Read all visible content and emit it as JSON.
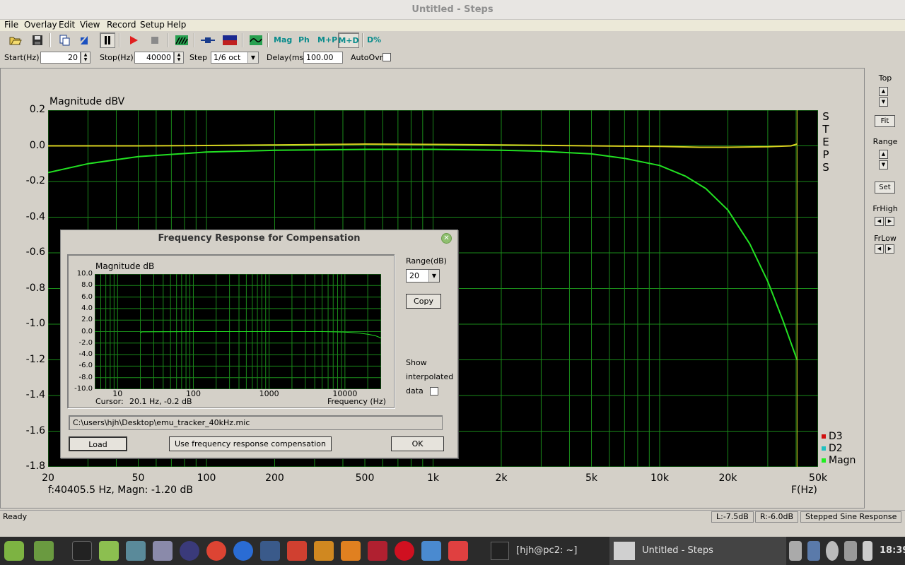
{
  "window": {
    "title": "Untitled - Steps"
  },
  "menu": [
    "File",
    "Overlay",
    "Edit",
    "View",
    "Record",
    "Setup",
    "Help"
  ],
  "toolbar": {
    "icons": [
      "open-icon",
      "save-icon",
      "copy-icon",
      "cursor-icon",
      "pause-icon",
      "play-icon",
      "stop-icon",
      "sweep-icon",
      "probe-icon",
      "calibrate-icon",
      "spectrum-icon"
    ],
    "mag_label": "Mag",
    "ph_label": "Ph",
    "mp_label": "M+P",
    "md_label": "M+D",
    "dpct_label": "D%"
  },
  "params": {
    "start_label": "Start(Hz)",
    "start_value": "20",
    "stop_label": "Stop(Hz)",
    "stop_value": "40000",
    "step_label": "Step",
    "step_value": "1/6 oct",
    "delay_label": "Delay(ms)",
    "delay_value": "100.00",
    "autoovr_label": "AutoOvr"
  },
  "chart_data": [
    {
      "type": "line",
      "title": "Magnitude dBV",
      "xlabel": "F(Hz)",
      "xscale": "log",
      "xlim": [
        20,
        50000
      ],
      "ylim": [
        -1.8,
        0.2
      ],
      "x_ticks": [
        "20",
        "50",
        "100",
        "200",
        "500",
        "1k",
        "2k",
        "5k",
        "10k",
        "20k",
        "50k"
      ],
      "y_ticks": [
        "0.2",
        "0.0",
        "-0.2",
        "-0.4",
        "-0.6",
        "-0.8",
        "-1.0",
        "-1.2",
        "-1.4",
        "-1.6",
        "-1.8"
      ],
      "grid": true,
      "side_label": "STEPS",
      "legend": [
        "D3",
        "D2",
        "Magn"
      ],
      "legend_colors": [
        "#d01010",
        "#20c0c0",
        "#20ee20"
      ],
      "cursor_x": 40405.5,
      "series": [
        {
          "name": "Magn",
          "color": "#22e022",
          "x": [
            20,
            30,
            50,
            100,
            200,
            500,
            1000,
            2000,
            3000,
            5000,
            7000,
            10000,
            13000,
            16000,
            20000,
            25000,
            30000,
            35000,
            40405
          ],
          "y": [
            -0.15,
            -0.1,
            -0.06,
            -0.035,
            -0.025,
            -0.02,
            -0.02,
            -0.025,
            -0.03,
            -0.045,
            -0.07,
            -0.11,
            -0.17,
            -0.24,
            -0.36,
            -0.55,
            -0.76,
            -0.98,
            -1.2
          ]
        },
        {
          "color": "#d8d020",
          "x": [
            20,
            50,
            100,
            200,
            500,
            1000,
            2000,
            5000,
            10000,
            15000,
            20000,
            30000,
            38000,
            40405
          ],
          "y": [
            0.0,
            0.0,
            0.002,
            0.005,
            0.01,
            0.008,
            0.005,
            0.0,
            -0.003,
            -0.008,
            -0.008,
            -0.005,
            0.0,
            0.01
          ]
        }
      ]
    },
    {
      "type": "line",
      "title": "Magnitude dB",
      "xlabel": "Frequency (Hz)",
      "xscale": "log",
      "xlim": [
        5,
        30000
      ],
      "ylim": [
        -10,
        10
      ],
      "x_ticks": [
        "10",
        "100",
        "1000",
        "10000"
      ],
      "y_ticks": [
        "10.0",
        "8.0",
        "6.0",
        "4.0",
        "2.0",
        "0.0",
        "-2.0",
        "-4.0",
        "-6.0",
        "-8.0",
        "-10.0"
      ],
      "grid": true,
      "series": [
        {
          "color": "#22e022",
          "x": [
            20,
            21,
            100,
            1000,
            5000,
            10000,
            15000,
            20000,
            25000,
            30000
          ],
          "y": [
            -0.2,
            -0.05,
            0.0,
            0.0,
            0.0,
            -0.1,
            -0.25,
            -0.45,
            -0.7,
            -1.1
          ]
        }
      ]
    }
  ],
  "main": {
    "readout": "f:40405.5 Hz, Magn: -1.20 dB"
  },
  "right_panel": {
    "top_label": "Top",
    "fit_label": "Fit",
    "range_label": "Range",
    "set_label": "Set",
    "frhigh_label": "FrHigh",
    "frlow_label": "FrLow"
  },
  "dialog": {
    "title": "Frequency Response for Compensation",
    "cursor_label": "Cursor:",
    "cursor_value": "20.1 Hz, -0.2 dB",
    "range_label": "Range(dB)",
    "range_value": "20",
    "copy_label": "Copy",
    "show_label_1": "Show",
    "show_label_2": "interpolated",
    "show_label_3": "data",
    "file_path": "C:\\users\\hjh\\Desktop\\emu_tracker_40kHz.mic",
    "load_label": "Load",
    "use_comp_label": "Use frequency response compensation",
    "ok_label": "OK"
  },
  "status": {
    "ready": "Ready",
    "left": "L:-7.5dB",
    "right": "R:-6.0dB",
    "mode": "Stepped Sine Response"
  },
  "taskbar": {
    "terminal_title": "[hjh@pc2: ~]",
    "app_title": "Untitled - Steps",
    "clock": "18:39"
  }
}
